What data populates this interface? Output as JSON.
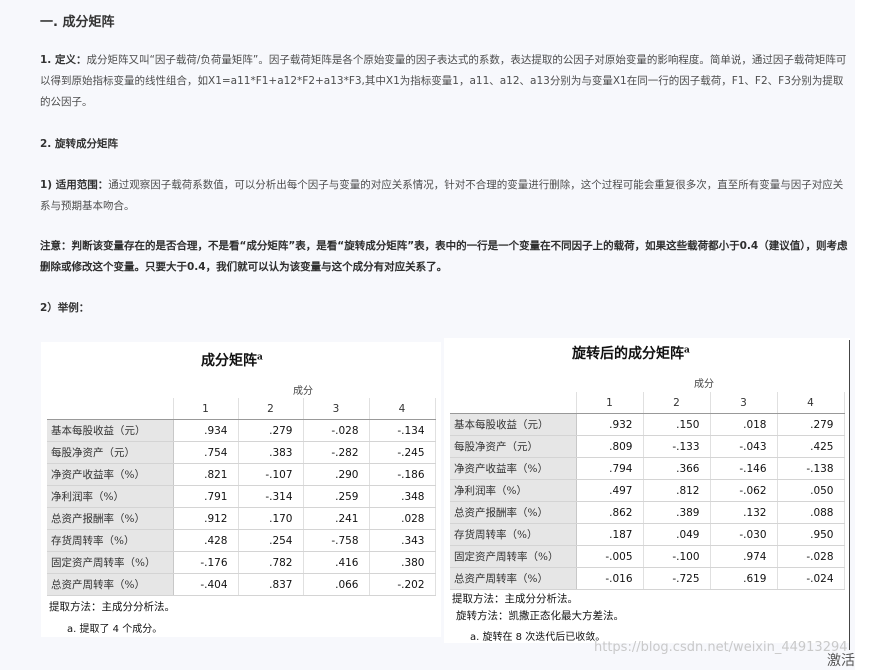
{
  "section_title": "一. 成分矩阵",
  "definition": {
    "label": "1. 定义：",
    "text": "成分矩阵又叫“因子载荷/负荷量矩阵”。因子载荷矩阵是各个原始变量的因子表达式的系数，表达提取的公因子对原始变量的影响程度。简单说，通过因子载荷矩阵可以得到原始指标变量的线性组合，如X1=a11*F1+a12*F2+a13*F3,其中X1为指标变量1，a11、a12、a13分别为与变量X1在同一行的因子载荷，F1、F2、F3分别为提取的公因子。"
  },
  "rotation_title": "2. 旋转成分矩阵",
  "scope": {
    "label": "1) 适用范围：",
    "text": "通过观察因子载荷系数值，可以分析出每个因子与变量的对应关系情况，针对不合理的变量进行删除，这个过程可能会重复很多次，直至所有变量与因子对应关系与预期基本吻合。"
  },
  "note": "注意：判断该变量存在的是否合理，不是看“成分矩阵”表，是看“旋转成分矩阵”表，表中的一行是一个变量在不同因子上的载荷，如果这些载荷都小于0.4（建议值），则考虑删除或修改这个变量。只要大于0.4，我们就可以认为该变量与这个成分有对应关系了。",
  "example_label": "2）举例：",
  "component_matrix": {
    "title": "成分矩阵",
    "title_sup": "a",
    "group_header": "成分",
    "columns": [
      "1",
      "2",
      "3",
      "4"
    ],
    "rows": [
      {
        "label": "基本每股收益（元）",
        "values": [
          ".934",
          ".279",
          "-.028",
          "-.134"
        ]
      },
      {
        "label": "每股净资产（元）",
        "values": [
          ".754",
          ".383",
          "-.282",
          "-.245"
        ]
      },
      {
        "label": "净资产收益率（%）",
        "values": [
          ".821",
          "-.107",
          ".290",
          "-.186"
        ]
      },
      {
        "label": "净利润率（%）",
        "values": [
          ".791",
          "-.314",
          ".259",
          ".348"
        ]
      },
      {
        "label": "总资产报酬率（%）",
        "values": [
          ".912",
          ".170",
          ".241",
          ".028"
        ]
      },
      {
        "label": "存货周转率（%）",
        "values": [
          ".428",
          ".254",
          "-.758",
          ".343"
        ]
      },
      {
        "label": "固定资产周转率（%）",
        "values": [
          "-.176",
          ".782",
          ".416",
          ".380"
        ]
      },
      {
        "label": "总资产周转率（%）",
        "values": [
          "-.404",
          ".837",
          ".066",
          "-.202"
        ]
      }
    ],
    "footnote1": "提取方法：主成分分析法。",
    "footnote2": "a. 提取了 4 个成分。"
  },
  "rotated_matrix": {
    "title": "旋转后的成分矩阵",
    "title_sup": "a",
    "group_header": "成分",
    "columns": [
      "1",
      "2",
      "3",
      "4"
    ],
    "rows": [
      {
        "label": "基本每股收益（元）",
        "values": [
          ".932",
          ".150",
          ".018",
          ".279"
        ]
      },
      {
        "label": "每股净资产（元）",
        "values": [
          ".809",
          "-.133",
          "-.043",
          ".425"
        ]
      },
      {
        "label": "净资产收益率（%）",
        "values": [
          ".794",
          ".366",
          "-.146",
          "-.138"
        ]
      },
      {
        "label": "净利润率（%）",
        "values": [
          ".497",
          ".812",
          "-.062",
          ".050"
        ]
      },
      {
        "label": "总资产报酬率（%）",
        "values": [
          ".862",
          ".389",
          ".132",
          ".088"
        ]
      },
      {
        "label": "存货周转率（%）",
        "values": [
          ".187",
          ".049",
          "-.030",
          ".950"
        ]
      },
      {
        "label": "固定资产周转率（%）",
        "values": [
          "-.005",
          "-.100",
          ".974",
          "-.028"
        ]
      },
      {
        "label": "总资产周转率（%）",
        "values": [
          "-.016",
          "-.725",
          ".619",
          "-.024"
        ]
      }
    ],
    "footnote1": "提取方法：主成分分析法。",
    "footnote2": "旋转方法：凯撒正态化最大方差法。",
    "footnote3": "a. 旋转在 8 次迭代后已收敛。"
  },
  "watermark": "https://blog.csdn.net/weixin_44913294",
  "activate_text": "激活"
}
